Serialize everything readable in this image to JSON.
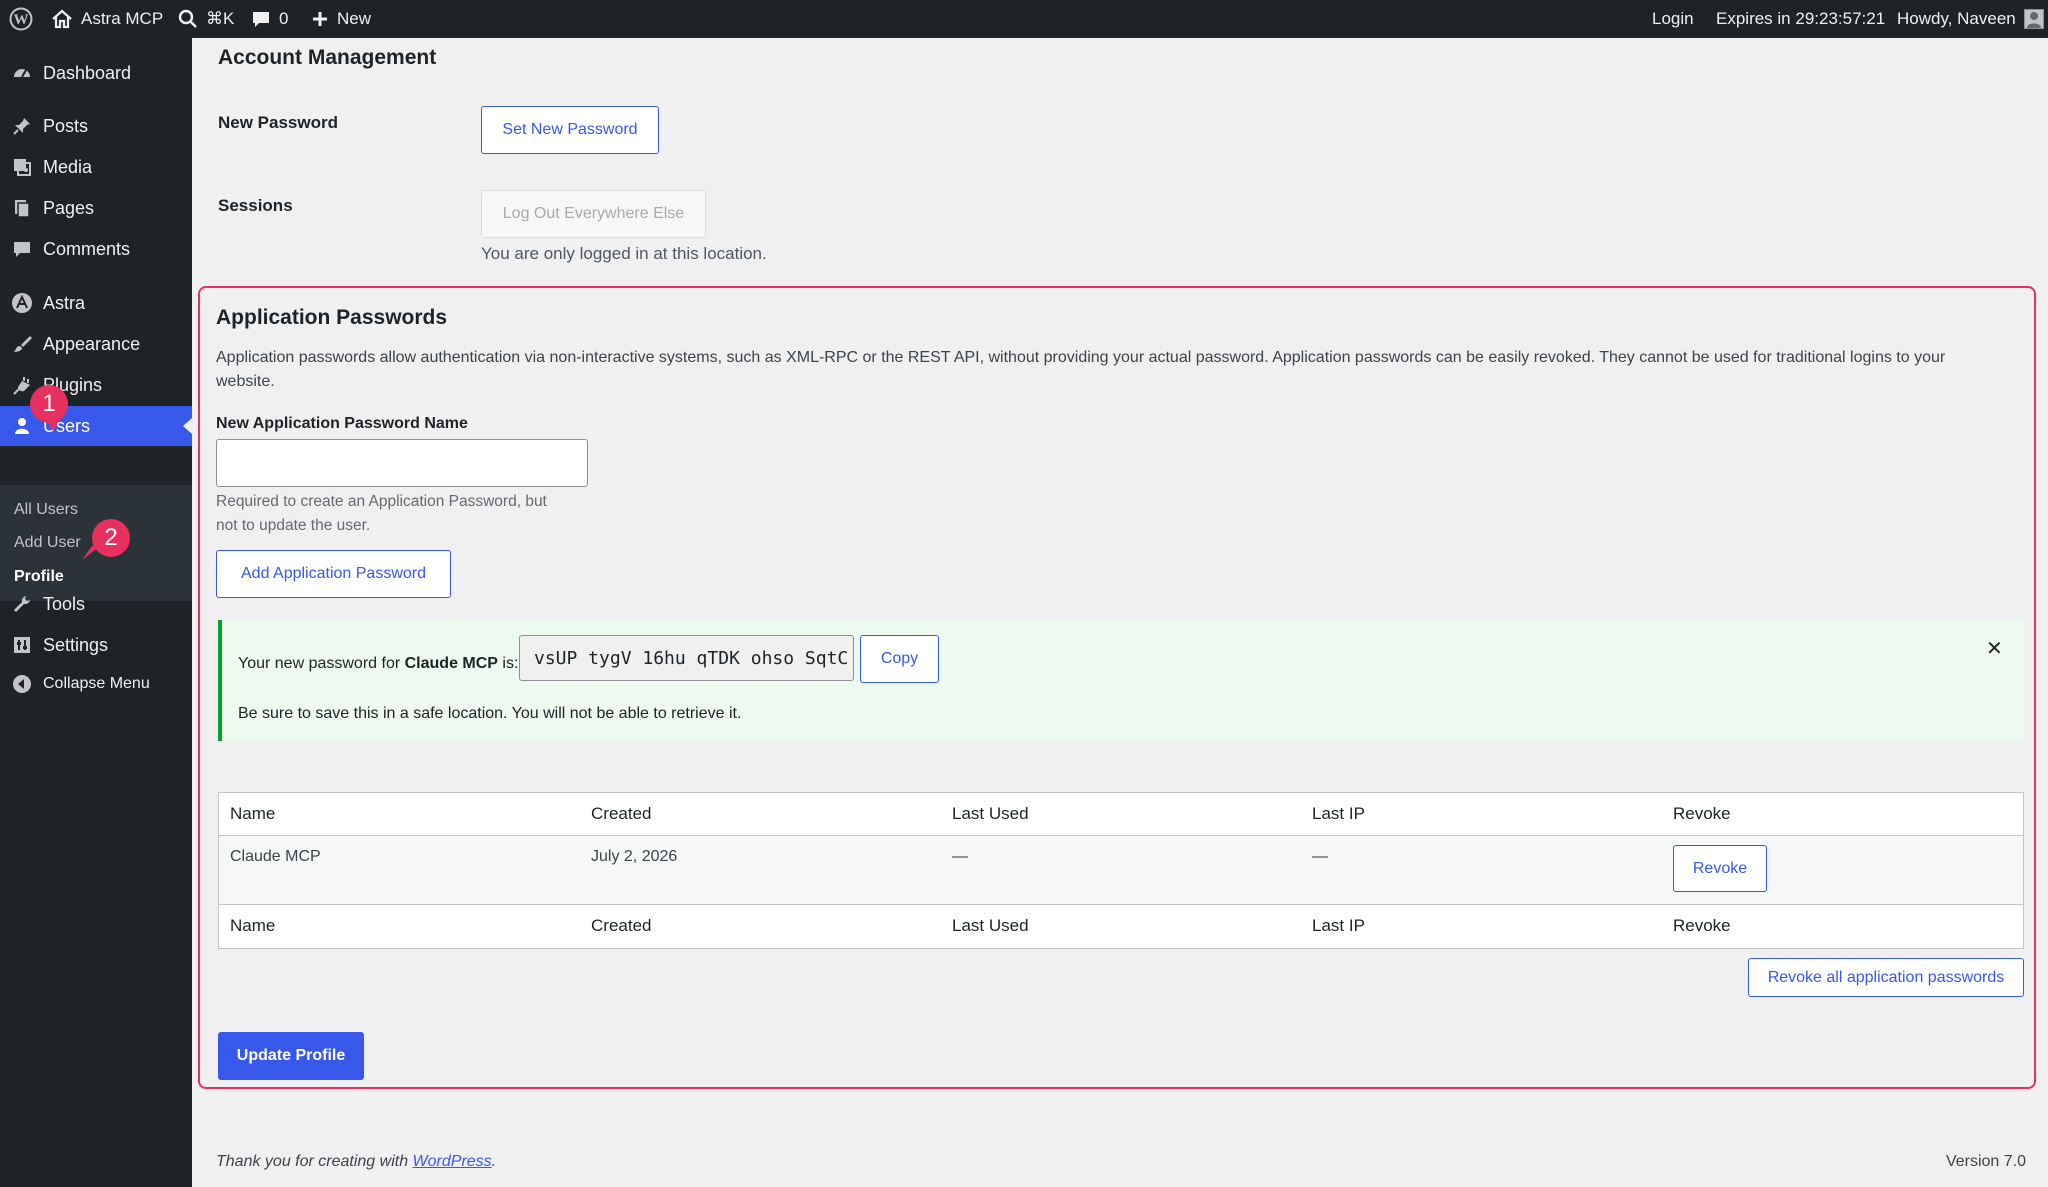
{
  "admin_bar": {
    "site_name": "Astra MCP",
    "search_shortcut": "⌘K",
    "comments_count": "0",
    "new_label": "New",
    "login_label": "Login",
    "expires_text": "Expires in 29:23:57:21",
    "howdy_text": "Howdy, Naveen"
  },
  "sidebar": {
    "items": [
      {
        "label": "Dashboard",
        "icon": "dashboard-icon"
      },
      {
        "label": "Posts",
        "icon": "pin-icon"
      },
      {
        "label": "Media",
        "icon": "media-icon"
      },
      {
        "label": "Pages",
        "icon": "pages-icon"
      },
      {
        "label": "Comments",
        "icon": "comment-icon"
      },
      {
        "label": "Astra",
        "icon": "astra-icon"
      },
      {
        "label": "Appearance",
        "icon": "brush-icon"
      },
      {
        "label": "Plugins",
        "icon": "plugin-icon"
      },
      {
        "label": "Users",
        "icon": "user-icon"
      },
      {
        "label": "Tools",
        "icon": "wrench-icon"
      },
      {
        "label": "Settings",
        "icon": "settings-icon"
      },
      {
        "label": "Collapse Menu",
        "icon": "collapse-icon"
      }
    ],
    "users_submenu": [
      "All Users",
      "Add User",
      "Profile"
    ],
    "badges": [
      "1",
      "2"
    ]
  },
  "account": {
    "heading": "Account Management",
    "new_password_label": "New Password",
    "set_new_password_button": "Set New Password",
    "sessions_label": "Sessions",
    "logout_everywhere_button": "Log Out Everywhere Else",
    "sessions_desc": "You are only logged in at this location."
  },
  "app_passwords": {
    "heading": "Application Passwords",
    "description_line1": "Application passwords allow authentication via non-interactive systems, such as XML-RPC or the REST API, without providing your actual password. Application passwords can be easily revoked. They cannot be used for traditional logins to your",
    "description_line2": "website.",
    "name_label": "New Application Password Name",
    "name_value": "",
    "help_line1": "Required to create an Application Password, but",
    "help_line2": "not to update the user.",
    "add_button": "Add Application Password",
    "notice": {
      "prefix": "Your new password for",
      "app_name": "Claude MCP",
      "suffix": "is:",
      "password": "vsUP tygV 16hu qTDK ohso SqtC",
      "copy_button": "Copy",
      "warning": "Be sure to save this in a safe location. You will not be able to retrieve it.",
      "dismiss": "✕"
    },
    "table": {
      "headers": [
        "Name",
        "Created",
        "Last Used",
        "Last IP",
        "Revoke"
      ],
      "rows": [
        {
          "name": "Claude MCP",
          "created": "July 2, 2026",
          "last_used": "—",
          "last_ip": "—",
          "revoke_button": "Revoke"
        }
      ]
    },
    "revoke_all_button": "Revoke all application passwords",
    "update_button": "Update Profile"
  },
  "footer": {
    "thanks_prefix": "Thank you for creating with",
    "thanks_link": "WordPress",
    "thanks_suffix": ".",
    "version": "Version 7.0"
  },
  "colors": {
    "accent": "#3858e9",
    "highlight": "#e8305f",
    "success": "#00a32a",
    "adminbar": "#1d2327"
  }
}
